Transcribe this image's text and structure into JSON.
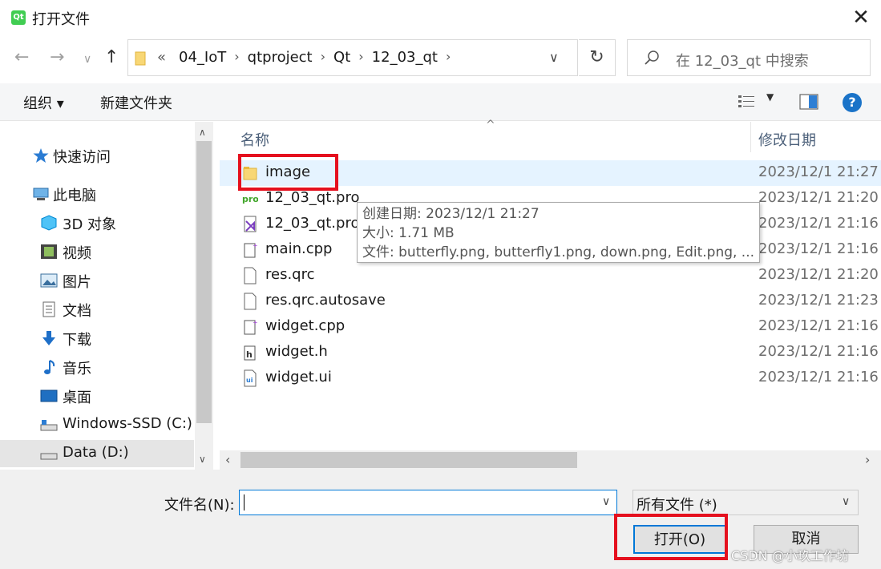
{
  "window": {
    "title": "打开文件",
    "app_icon_text": "Qt"
  },
  "address": {
    "crumbs": [
      "«",
      "04_IoT",
      "qtproject",
      "Qt",
      "12_03_qt"
    ],
    "search_placeholder": "在 12_03_qt 中搜索"
  },
  "toolbar": {
    "organize": "组织 ▾",
    "new_folder": "新建文件夹",
    "help": "?"
  },
  "nav": {
    "items": [
      {
        "label": "快速访问",
        "icon": "star-icon"
      },
      {
        "label": "此电脑",
        "icon": "computer-icon"
      },
      {
        "label": "3D 对象",
        "icon": "cube-icon"
      },
      {
        "label": "视频",
        "icon": "video-icon"
      },
      {
        "label": "图片",
        "icon": "picture-icon"
      },
      {
        "label": "文档",
        "icon": "document-icon"
      },
      {
        "label": "下载",
        "icon": "download-icon"
      },
      {
        "label": "音乐",
        "icon": "music-icon"
      },
      {
        "label": "桌面",
        "icon": "desktop-icon"
      },
      {
        "label": "Windows-SSD (C:)",
        "icon": "drive-icon"
      },
      {
        "label": "Data (D:)",
        "icon": "drive-icon"
      }
    ]
  },
  "list": {
    "columns": {
      "name": "名称",
      "date": "修改日期"
    },
    "rows": [
      {
        "name": "image",
        "date": "2023/12/1 21:27",
        "icon": "folder-icon"
      },
      {
        "name": "12_03_qt.pro",
        "date": "2023/12/1 21:20",
        "icon": "pro-file-icon"
      },
      {
        "name": "12_03_qt.pro",
        "date": "2023/12/1 21:16",
        "icon": "vs-file-icon"
      },
      {
        "name": "main.cpp",
        "date": "2023/12/1 21:16",
        "icon": "cpp-file-icon"
      },
      {
        "name": "res.qrc",
        "date": "2023/12/1 21:20",
        "icon": "file-icon"
      },
      {
        "name": "res.qrc.autosave",
        "date": "2023/12/1 21:23",
        "icon": "file-icon"
      },
      {
        "name": "widget.cpp",
        "date": "2023/12/1 21:16",
        "icon": "cpp-file-icon"
      },
      {
        "name": "widget.h",
        "date": "2023/12/1 21:16",
        "icon": "header-file-icon"
      },
      {
        "name": "widget.ui",
        "date": "2023/12/1 21:16",
        "icon": "ui-file-icon"
      }
    ]
  },
  "tooltip": {
    "created": "创建日期: 2023/12/1 21:27",
    "size": "大小: 1.71 MB",
    "files": "文件: butterfly.png, butterfly1.png, down.png, Edit.png, ..."
  },
  "bottom": {
    "filename_label": "文件名(N):",
    "filename_value": "",
    "filetype": "所有文件  (*)",
    "open": "打开(O)",
    "cancel": "取消"
  },
  "watermark": "CSDN @小玖工作坊",
  "colors": {
    "accent": "#0078d7",
    "highlight_row": "#e5f3ff",
    "annotation_red": "#e5101e"
  }
}
